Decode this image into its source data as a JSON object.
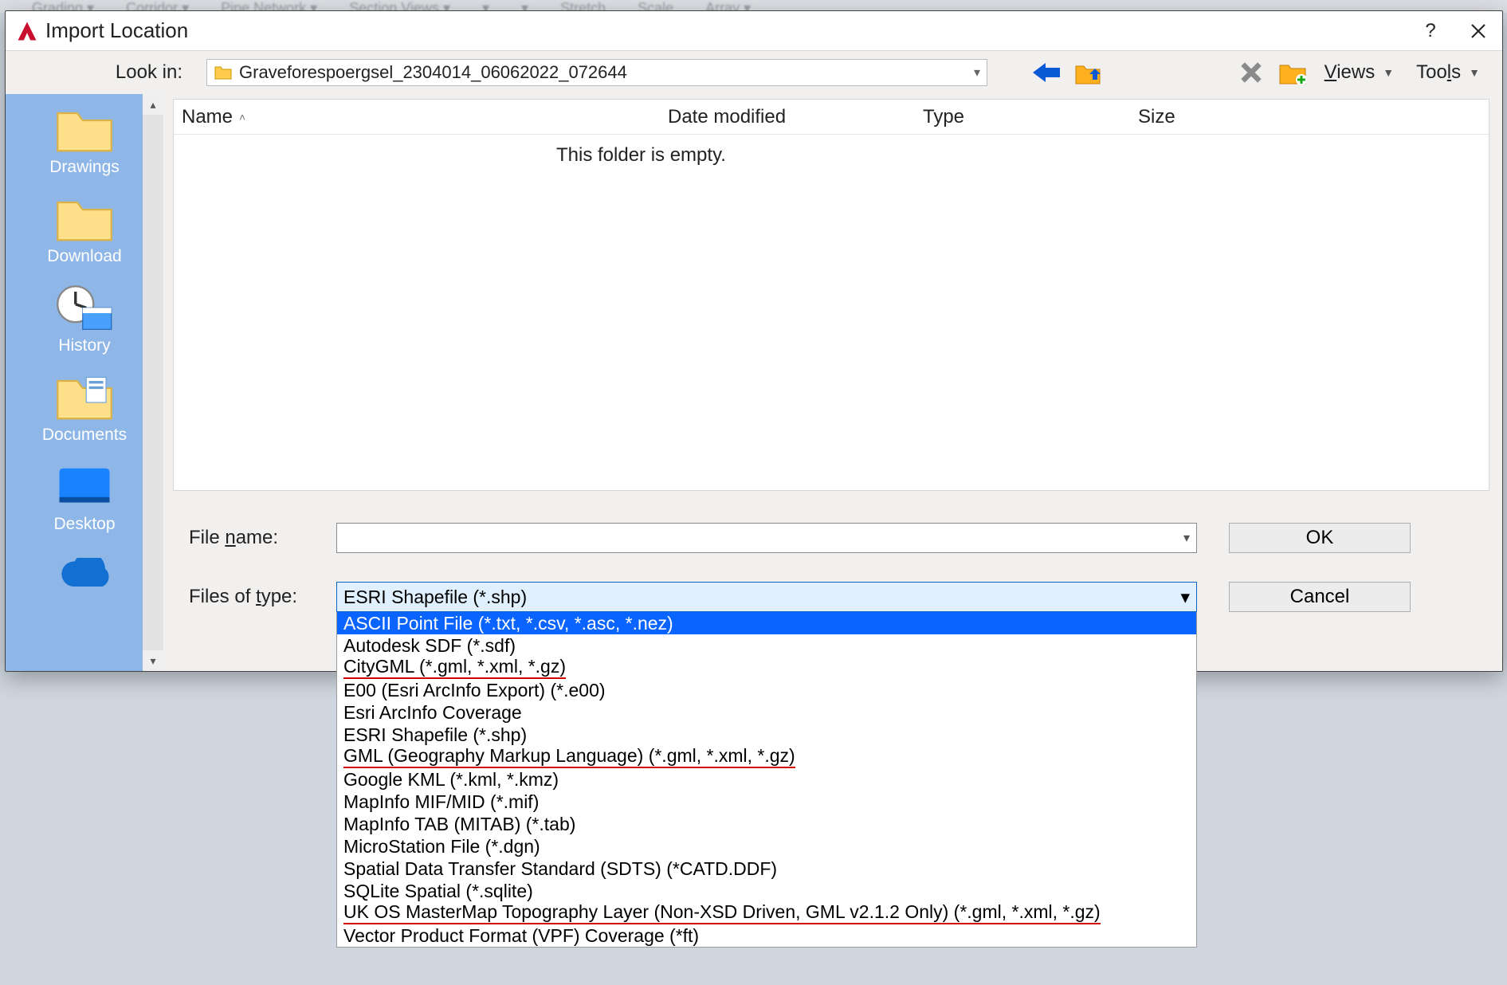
{
  "ribbon_hints": [
    "Grading ▾",
    "Corridor ▾",
    "Pipe Network ▾",
    "Section Views ▾",
    "▾",
    "▾",
    "Stretch",
    "Scale",
    "Array ▾"
  ],
  "dialog": {
    "title": "Import Location",
    "help_tip": "?",
    "look_in_label": "Look in:",
    "location_text": "Graveforespoergsel_2304014_06062022_072644",
    "views_label": "Views",
    "tools_label": "Tools",
    "columns": {
      "name": "Name",
      "date": "Date modified",
      "type": "Type",
      "size": "Size"
    },
    "empty_text": "This folder is empty.",
    "file_name_label": "File name:",
    "file_name_value": "",
    "files_of_type_label": "Files of type:",
    "selected_type": "ESRI Shapefile  (*.shp)",
    "ok_label": "OK",
    "cancel_label": "Cancel"
  },
  "places": [
    {
      "label": "Drawings",
      "icon": "folder"
    },
    {
      "label": "Download",
      "icon": "folder"
    },
    {
      "label": "History",
      "icon": "history"
    },
    {
      "label": "Documents",
      "icon": "docs"
    },
    {
      "label": "Desktop",
      "icon": "desktop"
    },
    {
      "label": "",
      "icon": "cloud"
    }
  ],
  "file_types": [
    {
      "label": "ASCII Point File  (*.txt, *.csv, *.asc, *.nez)",
      "highlight": true,
      "underline": false
    },
    {
      "label": "Autodesk SDF  (*.sdf)",
      "highlight": false,
      "underline": false
    },
    {
      "label": "CityGML (*.gml, *.xml, *.gz)",
      "highlight": false,
      "underline": true
    },
    {
      "label": "E00 (Esri ArcInfo Export) (*.e00)",
      "highlight": false,
      "underline": false
    },
    {
      "label": "Esri ArcInfo Coverage",
      "highlight": false,
      "underline": false
    },
    {
      "label": "ESRI Shapefile  (*.shp)",
      "highlight": false,
      "underline": false
    },
    {
      "label": "GML (Geography Markup Language) (*.gml, *.xml, *.gz)",
      "highlight": false,
      "underline": true
    },
    {
      "label": "Google KML (*.kml, *.kmz)",
      "highlight": false,
      "underline": false
    },
    {
      "label": "MapInfo MIF/MID (*.mif)",
      "highlight": false,
      "underline": false
    },
    {
      "label": "MapInfo TAB (MITAB) (*.tab)",
      "highlight": false,
      "underline": false
    },
    {
      "label": "MicroStation File  (*.dgn)",
      "highlight": false,
      "underline": false
    },
    {
      "label": "Spatial Data Transfer Standard (SDTS) (*CATD.DDF)",
      "highlight": false,
      "underline": false
    },
    {
      "label": "SQLite Spatial  (*.sqlite)",
      "highlight": false,
      "underline": false
    },
    {
      "label": "UK OS MasterMap Topography Layer (Non-XSD Driven, GML v2.1.2 Only) (*.gml, *.xml, *.gz)",
      "highlight": false,
      "underline": true
    },
    {
      "label": "Vector Product Format (VPF) Coverage (*ft)",
      "highlight": false,
      "underline": false
    }
  ]
}
